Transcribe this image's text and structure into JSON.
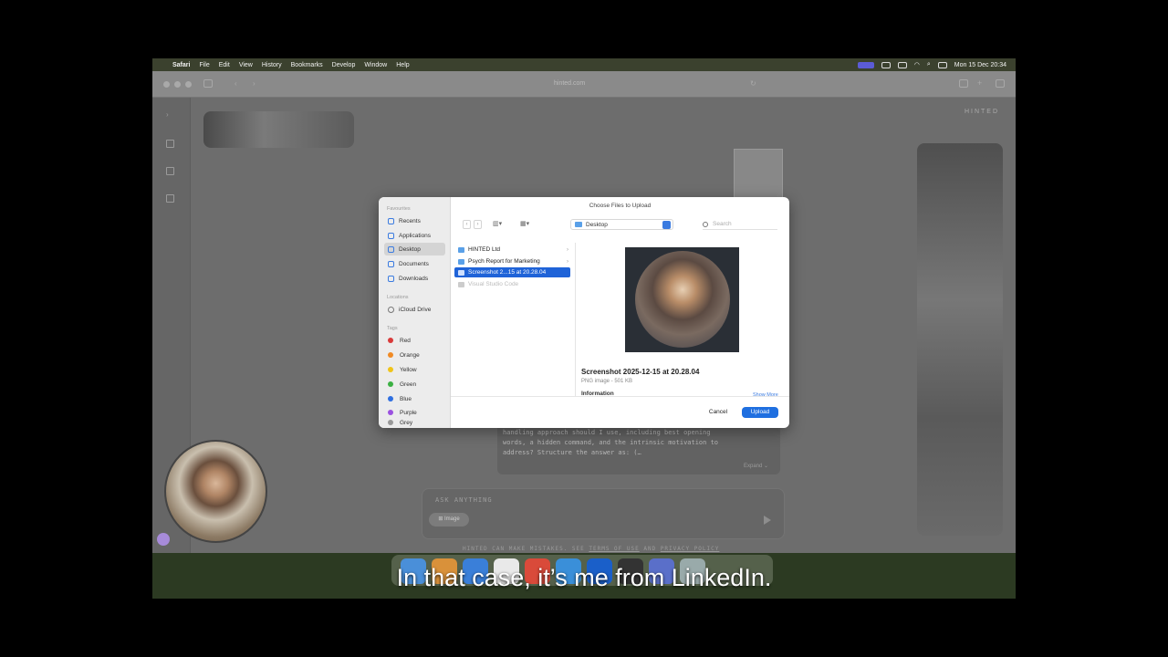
{
  "menubar": {
    "app": "Safari",
    "items": [
      "File",
      "Edit",
      "View",
      "History",
      "Bookmarks",
      "Develop",
      "Window",
      "Help"
    ],
    "clock": "Mon 15 Dec 20:34"
  },
  "safari": {
    "url": "hinted.com"
  },
  "page": {
    "brand": "HINTED",
    "chat_text": "handling approach should I use, including best opening\nwords, a hidden command, and the intrinsic motivation to\naddress? Structure the answer as: (…",
    "expand_label": "Expand ⌄",
    "ask_placeholder": "ASK ANYTHING",
    "image_button": "⊞ Image",
    "disclaimer_prefix": "HINTED CAN MAKE MISTAKES. SEE ",
    "terms_link": "TERMS OF USE",
    "disclaimer_and": " AND ",
    "privacy_link": "PRIVACY POLICY"
  },
  "dialog": {
    "title": "Choose Files to Upload",
    "sidebar": {
      "favourites_heading": "Favourites",
      "favourites": [
        "Recents",
        "Applications",
        "Desktop",
        "Documents",
        "Downloads"
      ],
      "locations_heading": "Locations",
      "locations": [
        "iCloud Drive"
      ],
      "tags_heading": "Tags",
      "tags": [
        "Red",
        "Orange",
        "Yellow",
        "Green",
        "Blue",
        "Purple",
        "Grey"
      ]
    },
    "location": "Desktop",
    "search_placeholder": "Search",
    "files": [
      {
        "name": "HINTED Ltd",
        "state": "folder"
      },
      {
        "name": "Psych Report for Marketing",
        "state": "folder"
      },
      {
        "name": "Screenshot 2...15 at 20.28.04",
        "state": "selected"
      },
      {
        "name": "Visual Studio Code",
        "state": "disabled"
      }
    ],
    "preview": {
      "name": "Screenshot 2025-12-15 at 20.28.04",
      "meta": "PNG image - 501 KB",
      "info_heading": "Information",
      "show_more": "Show More"
    },
    "cancel_label": "Cancel",
    "upload_label": "Upload"
  },
  "caption": "In that case, it’s me from LinkedIn.",
  "colors": {
    "accent": "#1f6fe0",
    "tag_colors": [
      "#d93a3a",
      "#f08a24",
      "#f0c419",
      "#3cb043",
      "#2f6fe0",
      "#9b51e0",
      "#999999"
    ]
  }
}
